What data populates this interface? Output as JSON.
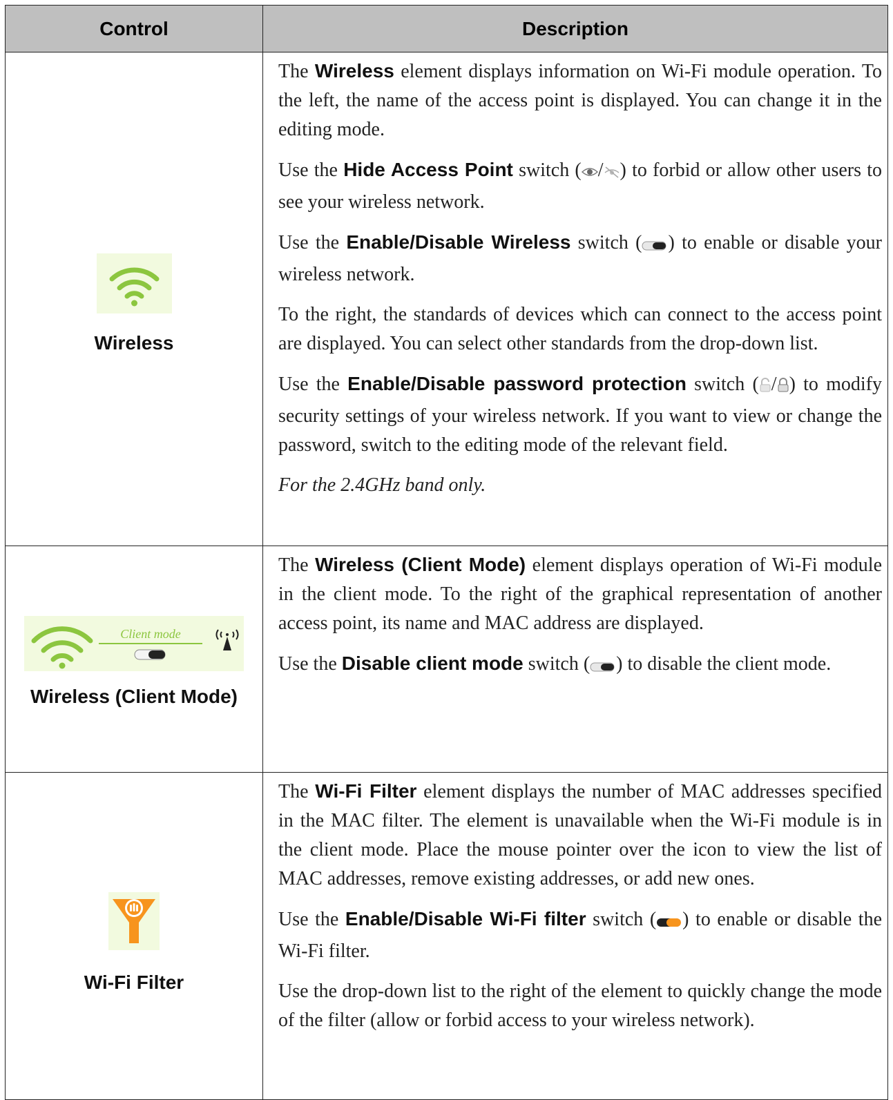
{
  "table": {
    "headers": {
      "control": "Control",
      "description": "Description"
    },
    "rows": [
      {
        "control": "Wireless",
        "icon": "wifi-signal-icon",
        "p1": {
          "a": "The ",
          "b": "Wireless",
          "c": " element displays information on Wi-Fi module operation. To the left, the name of the access point is displayed. You can change it in the editing mode."
        },
        "p2": {
          "a": "Use the ",
          "b": "Hide Access Point",
          "c": " switch (",
          "d": ") to forbid or allow other users to see your wireless network."
        },
        "p3": {
          "a": "Use the ",
          "b": "Enable/Disable Wireless",
          "c": " switch (",
          "d": ") to enable or disable your wireless network."
        },
        "p4": "To the right, the standards of devices which can connect to the access point are displayed. You can select other standards from the drop-down list.",
        "p5": {
          "a": "Use the ",
          "b": "Enable/Disable password protection",
          "c": " switch (",
          "d": ") to modify security settings of your wireless network. If you want to view or change the password, switch to the editing mode of the relevant field."
        },
        "note": "For the 2.4GHz band only."
      },
      {
        "control": "Wireless (Client Mode)",
        "icon": "wifi-client-mode-icon",
        "icon_label": "Client mode",
        "p1": {
          "a": "The ",
          "b": "Wireless (Client Mode)",
          "c": " element displays operation of Wi-Fi module in the client mode. To the right of the graphical representation of another access point, its name and MAC address are displayed."
        },
        "p2": {
          "a": "Use the ",
          "b": "Disable client mode",
          "c": " switch (",
          "d": ") to disable the client mode."
        }
      },
      {
        "control": "Wi-Fi Filter",
        "icon": "wifi-filter-funnel-icon",
        "p1": {
          "a": "The ",
          "b": "Wi-Fi Filter",
          "c": " element displays the number of MAC addresses specified in the MAC filter. The element is unavailable when the Wi-Fi module is in the client mode. Place the mouse pointer over the icon to view the list of MAC addresses, remove existing addresses, or add new ones."
        },
        "p2": {
          "a": "Use the ",
          "b": "Enable/Disable Wi-Fi filter",
          "c": " switch (",
          "d": ") to enable or disable the Wi-Fi filter."
        },
        "p3": "Use the drop-down list to the right of the element to quickly change the mode of the filter (allow or forbid access to your wireless network)."
      }
    ],
    "separator": "/"
  },
  "colors": {
    "header_bg": "#bfbfbf",
    "wifi_green": "#8cc63f",
    "icon_bg": "#f2fadf",
    "filter_orange": "#f7941d"
  }
}
